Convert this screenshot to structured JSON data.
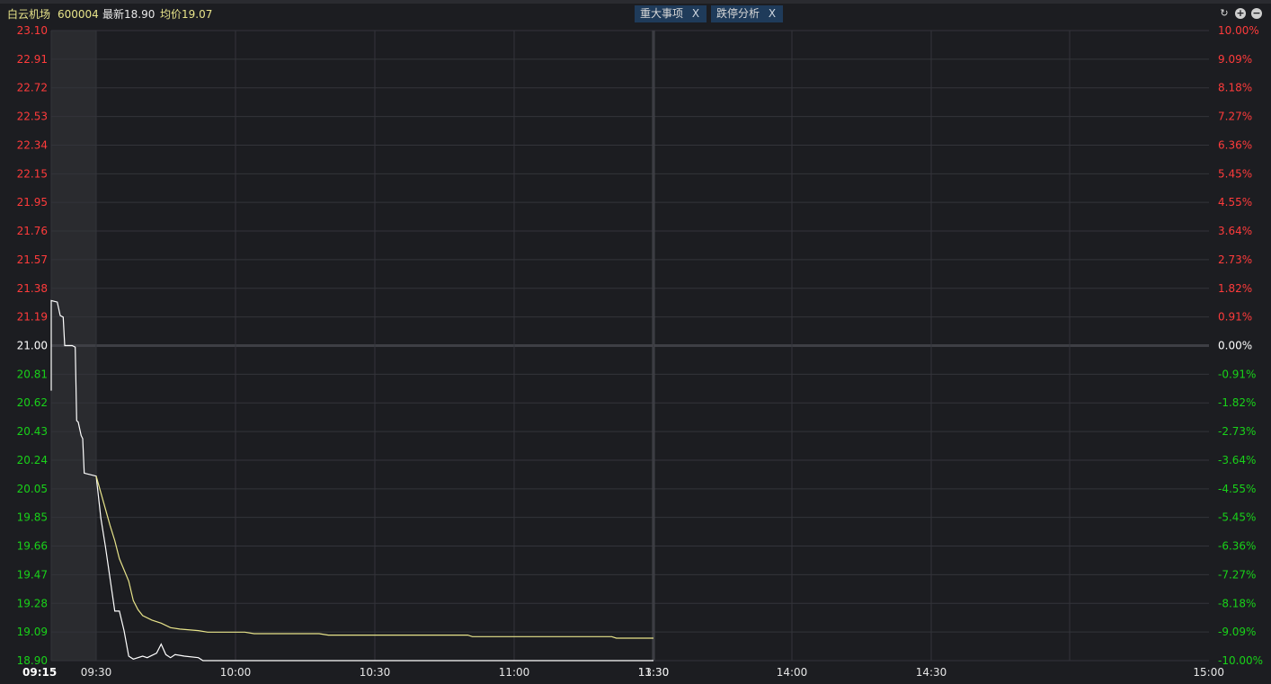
{
  "header": {
    "stock_name": "白云机场",
    "stock_code": "600004",
    "latest": "最新18.90",
    "avg": "均价19.07",
    "tags": [
      {
        "label": "重大事项",
        "close": "X"
      },
      {
        "label": "跌停分析",
        "close": "X"
      }
    ],
    "controls": {
      "refresh_icon": "↻",
      "zoom_in_icon": "+",
      "zoom_out_icon": "−"
    }
  },
  "colors": {
    "background": "#1c1d21",
    "grid": "#33343a",
    "up": "#ff3b3b",
    "down": "#19d219",
    "neutral": "#ffffff",
    "price_line": "#ffffff",
    "avg_line": "#e8e48a"
  },
  "chart_data": {
    "type": "line",
    "x_ticks": [
      "09:15",
      "09:30",
      "10:00",
      "10:30",
      "11:00",
      "11:30",
      "13:30",
      "14:00",
      "14:30",
      "15:00"
    ],
    "ylim": [
      18.9,
      23.1
    ],
    "ylim_pct": [
      -10.0,
      10.0
    ],
    "prev_close": 21.0,
    "left_ticks": [
      "23.10",
      "22.91",
      "22.72",
      "22.53",
      "22.34",
      "22.15",
      "21.95",
      "21.76",
      "21.57",
      "21.38",
      "21.19",
      "21.00",
      "20.81",
      "20.62",
      "20.43",
      "20.24",
      "20.05",
      "19.85",
      "19.66",
      "19.47",
      "19.28",
      "19.09",
      "18.90"
    ],
    "right_ticks": [
      "10.00%",
      "9.09%",
      "8.18%",
      "7.27%",
      "6.36%",
      "5.45%",
      "4.55%",
      "3.64%",
      "2.73%",
      "1.82%",
      "0.91%",
      "0.00%",
      "-0.91%",
      "-1.82%",
      "-2.73%",
      "-3.64%",
      "-4.55%",
      "-5.45%",
      "-6.36%",
      "-7.27%",
      "-8.18%",
      "-9.09%",
      "-10.00%"
    ],
    "series": [
      {
        "name": "最新",
        "points": [
          [
            "09:15",
            20.7
          ],
          [
            "09:15",
            21.3
          ],
          [
            "09:17",
            21.29
          ],
          [
            "09:18",
            21.2
          ],
          [
            "09:19",
            21.19
          ],
          [
            "09:19.5",
            21.0
          ],
          [
            "09:22",
            21.0
          ],
          [
            "09:23",
            20.99
          ],
          [
            "09:23.5",
            20.5
          ],
          [
            "09:24",
            20.49
          ],
          [
            "09:25",
            20.4
          ],
          [
            "09:25.5",
            20.38
          ],
          [
            "09:26",
            20.15
          ],
          [
            "09:30",
            20.13
          ],
          [
            "09:31",
            19.85
          ],
          [
            "09:32",
            19.66
          ],
          [
            "09:34",
            19.23
          ],
          [
            "09:35",
            19.23
          ],
          [
            "09:36",
            19.1
          ],
          [
            "09:37",
            18.93
          ],
          [
            "09:38",
            18.91
          ],
          [
            "09:40",
            18.93
          ],
          [
            "09:41",
            18.92
          ],
          [
            "09:43",
            18.95
          ],
          [
            "09:44",
            19.01
          ],
          [
            "09:45",
            18.94
          ],
          [
            "09:46",
            18.92
          ],
          [
            "09:47",
            18.94
          ],
          [
            "09:49",
            18.93
          ],
          [
            "09:52",
            18.92
          ],
          [
            "09:53",
            18.9
          ],
          [
            "11:30",
            18.9
          ]
        ]
      },
      {
        "name": "均价",
        "points": [
          [
            "09:30",
            20.13
          ],
          [
            "09:33",
            19.8
          ],
          [
            "09:34",
            19.7
          ],
          [
            "09:35",
            19.58
          ],
          [
            "09:37",
            19.43
          ],
          [
            "09:38",
            19.3
          ],
          [
            "09:39",
            19.24
          ],
          [
            "09:40",
            19.2
          ],
          [
            "09:42",
            19.17
          ],
          [
            "09:44",
            19.15
          ],
          [
            "09:46",
            19.12
          ],
          [
            "09:48",
            19.11
          ],
          [
            "09:52",
            19.1
          ],
          [
            "09:54",
            19.09
          ],
          [
            "10:02",
            19.09
          ],
          [
            "10:04",
            19.08
          ],
          [
            "10:18",
            19.08
          ],
          [
            "10:20",
            19.07
          ],
          [
            "10:50",
            19.07
          ],
          [
            "10:51",
            19.06
          ],
          [
            "11:21",
            19.06
          ],
          [
            "11:22",
            19.05
          ],
          [
            "11:30",
            19.05
          ]
        ]
      }
    ]
  }
}
